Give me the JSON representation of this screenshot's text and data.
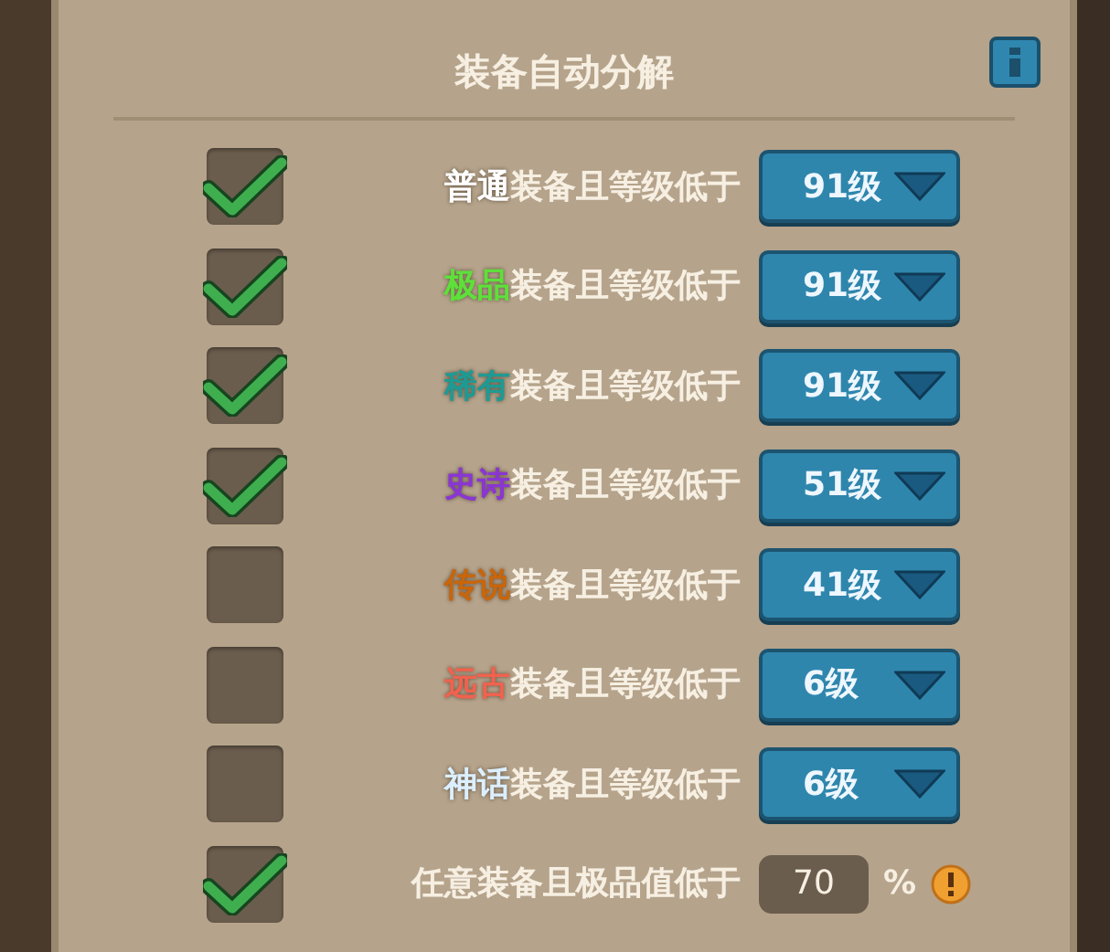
{
  "title": "装备自动分解",
  "rows": [
    {
      "kind": "dropdown",
      "checked": true,
      "quality": "普通",
      "color": "#ffffff",
      "label": "装备且等级低于",
      "value": "91级"
    },
    {
      "kind": "dropdown",
      "checked": true,
      "quality": "极品",
      "color": "#5ee03a",
      "label": "装备且等级低于",
      "value": "91级"
    },
    {
      "kind": "dropdown",
      "checked": true,
      "quality": "稀有",
      "color": "#1f9a93",
      "label": "装备且等级低于",
      "value": "91级"
    },
    {
      "kind": "dropdown",
      "checked": true,
      "quality": "史诗",
      "color": "#8a36d2",
      "label": "装备且等级低于",
      "value": "51级"
    },
    {
      "kind": "dropdown",
      "checked": false,
      "quality": "传说",
      "color": "#c9650a",
      "label": "装备且等级低于",
      "value": "41级"
    },
    {
      "kind": "dropdown",
      "checked": false,
      "quality": "远古",
      "color": "#f0624e",
      "label": "装备且等级低于",
      "value": "6级"
    },
    {
      "kind": "dropdown",
      "checked": false,
      "quality": "神话",
      "color": "#dcefff",
      "label": "装备且等级低于",
      "value": "6级"
    },
    {
      "kind": "input",
      "checked": true,
      "label": "任意装备且极品值低于",
      "value": "70",
      "unit": "%"
    }
  ]
}
